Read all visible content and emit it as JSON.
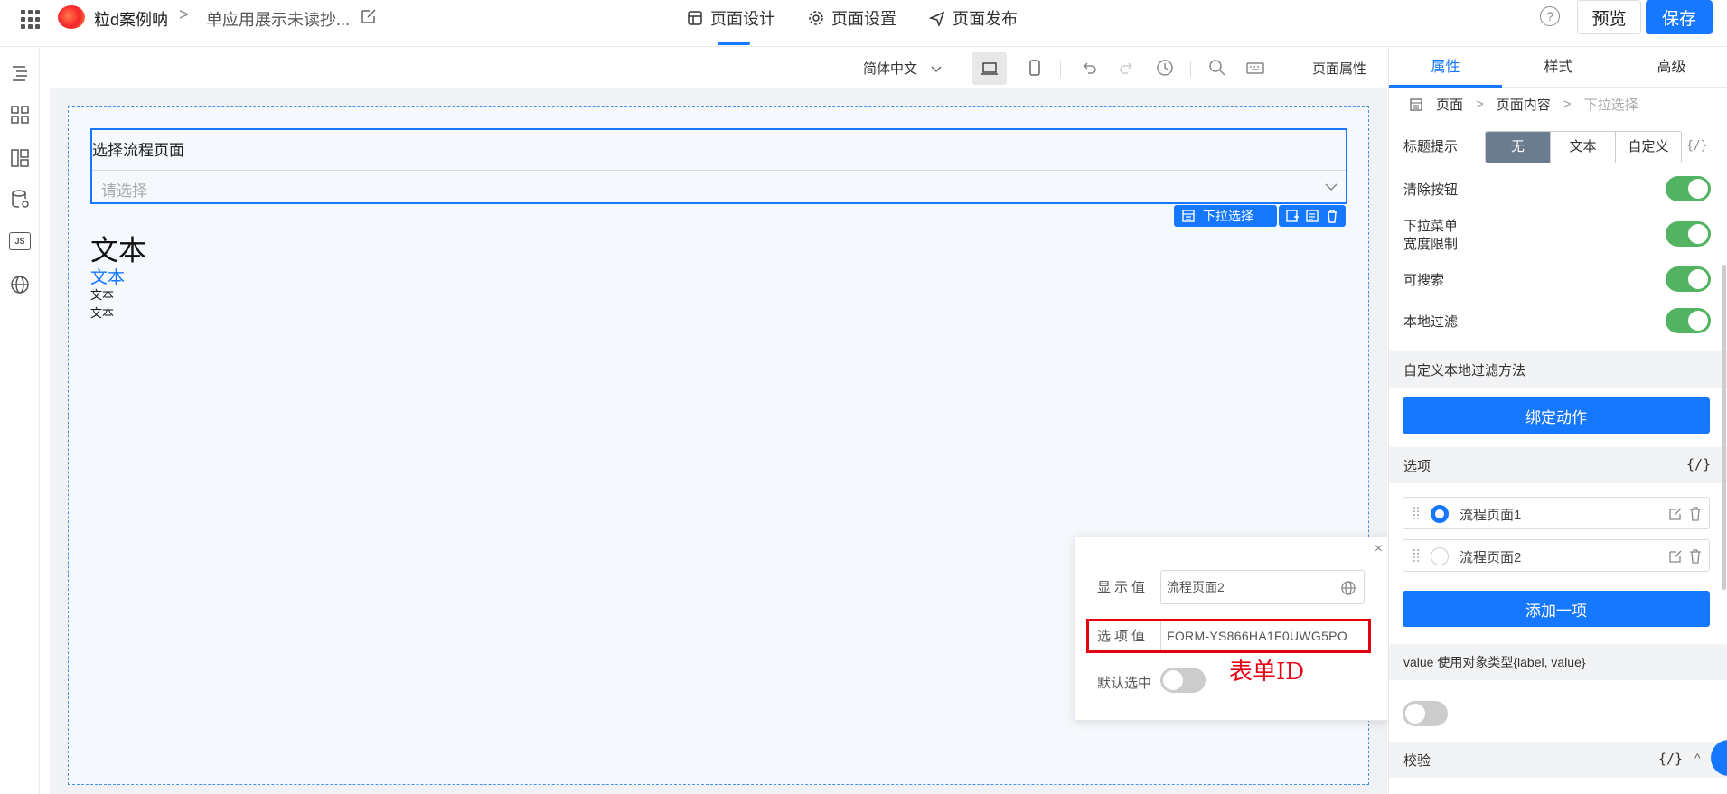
{
  "topbar": {
    "app_name": "粒d案例呐",
    "breadcrumb_sep": ">",
    "page_name": "单应用展示未读抄...",
    "tabs": [
      {
        "label": "页面设计",
        "icon": "layout-icon",
        "active": true
      },
      {
        "label": "页面设置",
        "icon": "gear-icon",
        "active": false
      },
      {
        "label": "页面发布",
        "icon": "send-icon",
        "active": false
      }
    ],
    "help": "?",
    "preview_label": "预览",
    "save_label": "保存"
  },
  "leftbar": {
    "icons": [
      "outline-tree-icon",
      "components-grid-icon",
      "layout-blocks-icon",
      "data-source-icon",
      "js-code-icon",
      "globe-icon"
    ],
    "js_label": "JS"
  },
  "canvas_toolbar": {
    "language": "简体中文",
    "page_props_label": "页面属性"
  },
  "canvas": {
    "select_label": "选择流程页面",
    "select_placeholder": "请选择",
    "component_tag": "下拉选择",
    "text_large": "文本",
    "text_link": "文本",
    "text_small_1": "文本",
    "text_small_2": "文本"
  },
  "option_popup": {
    "close": "×",
    "display_label": "显示值",
    "display_value": "流程页面2",
    "option_label": "选项值",
    "option_value": "FORM-YS866HA1F0UWG5PO",
    "default_label": "默认选中",
    "default_checked": false,
    "annotation": "表单ID",
    "annotation_color": "#e60012"
  },
  "right_panel": {
    "tabs": [
      {
        "label": "属性",
        "active": true
      },
      {
        "label": "样式",
        "active": false
      },
      {
        "label": "高级",
        "active": false
      }
    ],
    "breadcrumb": {
      "page": "页面",
      "content": "页面内容",
      "current": "下拉选择"
    },
    "title_hint": {
      "label": "标题提示",
      "options": [
        "无",
        "文本",
        "自定义"
      ],
      "selected": "无"
    },
    "code_toggle": "{/}",
    "toggles": [
      {
        "label": "清除按钮",
        "on": true
      },
      {
        "label_line1": "下拉菜单",
        "label_line2": "宽度限制",
        "on": true
      },
      {
        "label": "可搜索",
        "on": true
      },
      {
        "label": "本地过滤",
        "on": true
      }
    ],
    "custom_filter_section": "自定义本地过滤方法",
    "bind_action_label": "绑定动作",
    "options_section": "选项",
    "options": [
      {
        "label": "流程页面1",
        "checked": true
      },
      {
        "label": "流程页面2",
        "checked": false
      }
    ],
    "add_item_label": "添加一项",
    "value_object_section": "value 使用对象类型{label, value}",
    "value_object_on": false,
    "validate_section": "校验",
    "validate_chevron": "^"
  },
  "colors": {
    "accent": "#1677ff",
    "toggle_on": "#52b463",
    "highlight": "#e60012"
  }
}
